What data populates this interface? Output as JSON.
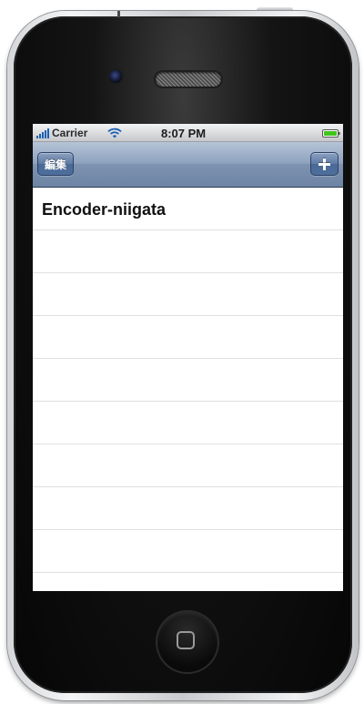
{
  "status_bar": {
    "carrier": "Carrier",
    "time": "8:07 PM",
    "signal_icon": "signal-bars-icon",
    "wifi_icon": "wifi-icon",
    "battery_icon": "battery-icon",
    "battery_color": "#3fc51c"
  },
  "nav_bar": {
    "edit_label": "編集",
    "add_icon": "plus-icon"
  },
  "table": {
    "rows": [
      {
        "label": "Encoder-niigata"
      },
      {
        "label": ""
      },
      {
        "label": ""
      },
      {
        "label": ""
      },
      {
        "label": ""
      },
      {
        "label": ""
      },
      {
        "label": ""
      },
      {
        "label": ""
      },
      {
        "label": ""
      },
      {
        "label": ""
      }
    ]
  },
  "colors": {
    "nav_tint": "#6d84a4",
    "signal_blue": "#1a5fb4"
  }
}
